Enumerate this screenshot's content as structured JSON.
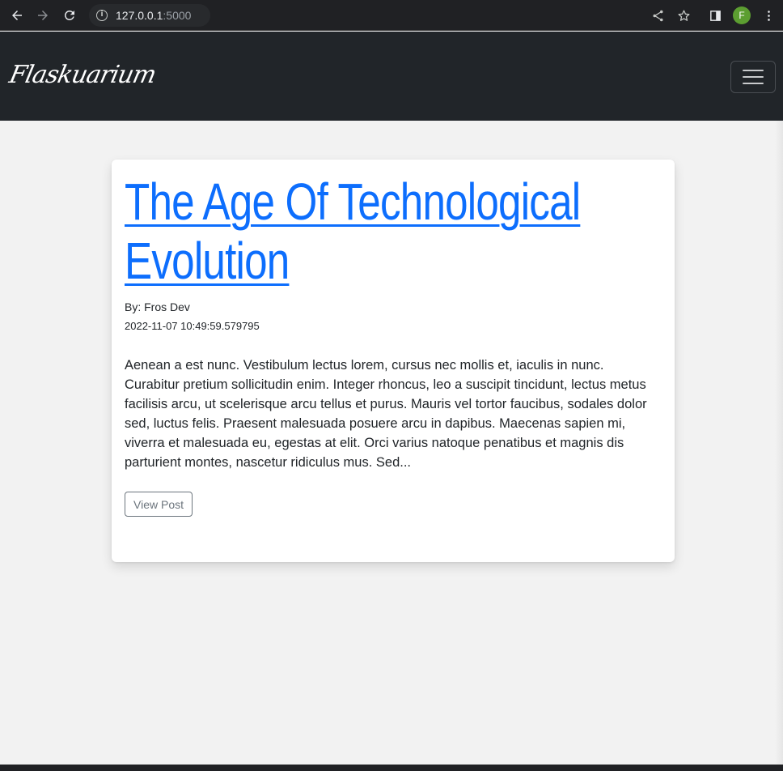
{
  "browser": {
    "url_host": "127.0.0.1",
    "url_port": ":5000",
    "profile_initial": "F",
    "profile_color": "#5c9e31",
    "icons": [
      "back-arrow-icon",
      "forward-arrow-icon",
      "reload-icon",
      "info-icon",
      "share-icon",
      "star-icon",
      "side-panel-icon",
      "more-vert-icon"
    ]
  },
  "navbar": {
    "brand": "Flaskuarium",
    "toggler_icon": "hamburger-icon",
    "background": "#212529"
  },
  "post": {
    "title_line1": "The Age Of Technological",
    "title_line2": "Evolution",
    "author": "By: Fros Dev",
    "timestamp": "2022-11-07 10:49:59.579795",
    "excerpt": "Aenean a est nunc. Vestibulum lectus lorem, cursus nec mollis et, iaculis in nunc. Curabitur pretium sollicitudin enim. Integer rhoncus, leo a suscipit tincidunt, lectus metus facilisis arcu, ut scelerisque arcu tellus et purus. Mauris vel tortor faucibus, sodales dolor sed, luctus felis. Praesent malesuada posuere arcu in dapibus. Maecenas sapien mi, viverra et malesuada eu, egestas at elit. Orci varius natoque penatibus et magnis dis parturient montes, nascetur ridiculus mus. Sed...",
    "button_label": "View Post",
    "link_color": "#0d6efd"
  }
}
